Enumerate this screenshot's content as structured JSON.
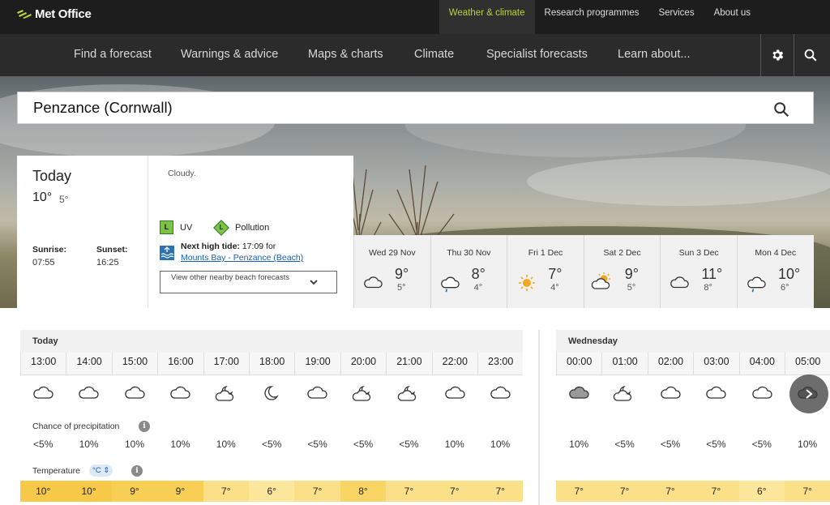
{
  "header": {
    "logo_text": "Met Office",
    "top_links": [
      "Weather & climate",
      "Research programmes",
      "Services",
      "About us"
    ],
    "active_top_link": "Weather & climate",
    "accent_color": "#b9d33a"
  },
  "nav": {
    "items": [
      "Find a forecast",
      "Warnings & advice",
      "Maps & charts",
      "Climate",
      "Specialist forecasts",
      "Learn about..."
    ],
    "icons": [
      "gear-icon",
      "search-icon"
    ]
  },
  "search": {
    "value": "Penzance (Cornwall)"
  },
  "today": {
    "title": "Today",
    "high": "10°",
    "low": "5°",
    "description": "Cloudy.",
    "uv_level": "L",
    "uv_label": "UV",
    "pollution_level": "L",
    "pollution_label": "Pollution",
    "sunrise_label": "Sunrise:",
    "sunrise": "07:55",
    "sunset_label": "Sunset:",
    "sunset": "16:25",
    "tide_label": "Next high tide:",
    "tide_time": "17:09 for",
    "tide_location": "Mounts Bay - Penzance (Beach)",
    "nearby_button": "View other nearby beach forecasts"
  },
  "days": [
    {
      "name": "Wed 29 Nov",
      "high": "9°",
      "low": "5°",
      "icon": "cloud-icon"
    },
    {
      "name": "Thu 30 Nov",
      "high": "8°",
      "low": "4°",
      "icon": "rain-cloud-icon"
    },
    {
      "name": "Fri 1 Dec",
      "high": "7°",
      "low": "4°",
      "icon": "sun-icon"
    },
    {
      "name": "Sat 2 Dec",
      "high": "9°",
      "low": "5°",
      "icon": "sun-cloud-icon"
    },
    {
      "name": "Sun 3 Dec",
      "high": "11°",
      "low": "8°",
      "icon": "cloud-icon"
    },
    {
      "name": "Mon 4 Dec",
      "high": "10°",
      "low": "6°",
      "icon": "rain-cloud-icon"
    }
  ],
  "hourly": {
    "precip_label": "Chance of precipitation",
    "temp_label": "Temperature",
    "unit": "°C",
    "today": {
      "label": "Today",
      "hours": [
        {
          "time": "13:00",
          "icon": "cloud-icon",
          "precip": "<5%",
          "temp": "10°"
        },
        {
          "time": "14:00",
          "icon": "cloud-icon",
          "precip": "10%",
          "temp": "10°"
        },
        {
          "time": "15:00",
          "icon": "cloud-icon",
          "precip": "10%",
          "temp": "9°"
        },
        {
          "time": "16:00",
          "icon": "cloud-icon",
          "precip": "10%",
          "temp": "9°"
        },
        {
          "time": "17:00",
          "icon": "partly-cloudy-night-icon",
          "precip": "10%",
          "temp": "7°"
        },
        {
          "time": "18:00",
          "icon": "moon-icon",
          "precip": "<5%",
          "temp": "6°"
        },
        {
          "time": "19:00",
          "icon": "cloud-icon",
          "precip": "<5%",
          "temp": "7°"
        },
        {
          "time": "20:00",
          "icon": "partly-cloudy-night-icon",
          "precip": "<5%",
          "temp": "8°"
        },
        {
          "time": "21:00",
          "icon": "partly-cloudy-night-icon",
          "precip": "<5%",
          "temp": "7°"
        },
        {
          "time": "22:00",
          "icon": "cloud-icon",
          "precip": "10%",
          "temp": "7°"
        },
        {
          "time": "23:00",
          "icon": "cloud-icon",
          "precip": "10%",
          "temp": "7°"
        }
      ]
    },
    "wednesday": {
      "label": "Wednesday",
      "hours": [
        {
          "time": "00:00",
          "icon": "grey-cloud-icon",
          "precip": "10%",
          "temp": "7°"
        },
        {
          "time": "01:00",
          "icon": "partly-cloudy-night-icon",
          "precip": "<5%",
          "temp": "7°"
        },
        {
          "time": "02:00",
          "icon": "cloud-icon",
          "precip": "<5%",
          "temp": "7°"
        },
        {
          "time": "03:00",
          "icon": "cloud-icon",
          "precip": "<5%",
          "temp": "7°"
        },
        {
          "time": "04:00",
          "icon": "cloud-icon",
          "precip": "<5%",
          "temp": "6°"
        },
        {
          "time": "05:00",
          "icon": "grey-cloud-icon",
          "precip": "10%",
          "temp": "7°"
        }
      ]
    }
  }
}
